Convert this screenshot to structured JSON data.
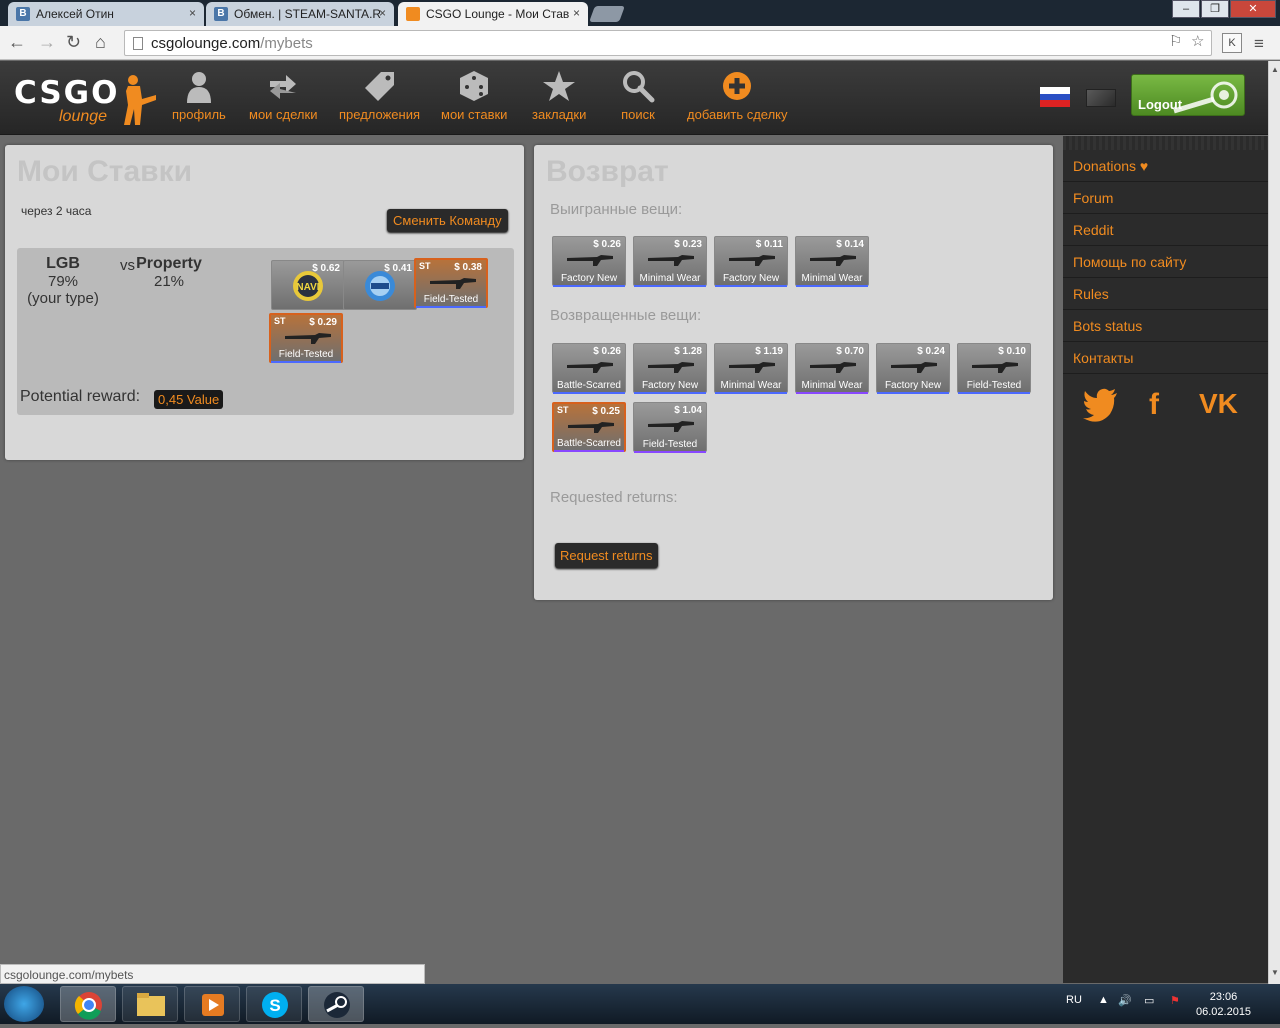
{
  "browser": {
    "tabs": [
      {
        "title": "Алексей Отин",
        "favicon": "vk-favicon",
        "icon_letter": "B"
      },
      {
        "title": "Обмен. | STEAM-SANTA.R",
        "favicon": "vk-favicon",
        "icon_letter": "B"
      },
      {
        "title": "CSGO Lounge - Мои Став",
        "favicon": "csgolounge-favicon",
        "icon_letter": "",
        "active": true
      }
    ],
    "close_glyph": "×",
    "url_domain": "csgolounge.com",
    "url_path": "/mybets",
    "status_url": "csgolounge.com/mybets",
    "ext_letter": "K"
  },
  "site": {
    "logo_text": "CSGO",
    "logo_sub": "lounge",
    "nav": [
      {
        "label": "профиль",
        "icon": "profile-icon"
      },
      {
        "label": "мои сделки",
        "icon": "trades-icon"
      },
      {
        "label": "предложения",
        "icon": "offers-tag-icon"
      },
      {
        "label": "мои ставки",
        "icon": "dice-icon"
      },
      {
        "label": "закладки",
        "icon": "star-icon"
      },
      {
        "label": "поиск",
        "icon": "search-icon"
      },
      {
        "label": "добавить сделку",
        "icon": "add-plus-icon"
      }
    ],
    "logout_label": "Logout"
  },
  "sidebar": {
    "links": [
      "Donations ♥",
      "Forum",
      "Reddit",
      "Помощь по сайту",
      "Rules",
      "Bots status",
      "Контакты"
    ],
    "social": [
      {
        "name": "twitter-icon",
        "glyph": "t"
      },
      {
        "name": "facebook-icon",
        "glyph": "f"
      },
      {
        "name": "vk-icon",
        "glyph": "VK"
      }
    ]
  },
  "my_bets": {
    "title": "Мои Ставки",
    "time_text": "через 2 часа",
    "change_team_label": "Сменить Команду",
    "team1": {
      "name": "LGB",
      "percent": "79%",
      "note": "(your type)"
    },
    "vs_text": "vs",
    "team2": {
      "name": "Property",
      "percent": "21%"
    },
    "items": [
      {
        "price": "$ 0.62",
        "condition": "",
        "st": false,
        "kind": "sticker-navi"
      },
      {
        "price": "$ 0.41",
        "condition": "",
        "st": false,
        "kind": "sticker-blue"
      },
      {
        "price": "$ 0.38",
        "condition": "Field-Tested",
        "st": true,
        "kind": "gun"
      },
      {
        "price": "$ 0.29",
        "condition": "Field-Tested",
        "st": true,
        "kind": "gun"
      }
    ],
    "reward_label": "Potential reward:",
    "reward_value": "0,45 Value"
  },
  "returns": {
    "title": "Возврат",
    "won_label": "Выигранные вещи:",
    "won_items": [
      {
        "price": "$ 0.26",
        "condition": "Factory New",
        "st": false,
        "bar": "#4b69ff"
      },
      {
        "price": "$ 0.23",
        "condition": "Minimal Wear",
        "st": false,
        "bar": "#4b69ff"
      },
      {
        "price": "$ 0.11",
        "condition": "Factory New",
        "st": false,
        "bar": "#4b69ff"
      },
      {
        "price": "$ 0.14",
        "condition": "Minimal Wear",
        "st": false,
        "bar": "#4b69ff"
      }
    ],
    "returned_label": "Возвращенные вещи:",
    "returned_items": [
      {
        "price": "$ 0.26",
        "condition": "Battle-Scarred",
        "st": false,
        "bar": "#4b69ff"
      },
      {
        "price": "$ 1.28",
        "condition": "Factory New",
        "st": false,
        "bar": "#4b69ff"
      },
      {
        "price": "$ 1.19",
        "condition": "Minimal Wear",
        "st": false,
        "bar": "#4b69ff"
      },
      {
        "price": "$ 0.70",
        "condition": "Minimal Wear",
        "st": false,
        "bar": "#8847ff"
      },
      {
        "price": "$ 0.24",
        "condition": "Factory New",
        "st": false,
        "bar": "#4b69ff"
      },
      {
        "price": "$ 0.10",
        "condition": "Field-Tested",
        "st": false,
        "bar": "#4b69ff"
      },
      {
        "price": "$ 0.25",
        "condition": "Battle-Scarred",
        "st": true,
        "bar": "#8847ff"
      },
      {
        "price": "$ 1.04",
        "condition": "Field-Tested",
        "st": false,
        "bar": "#8847ff"
      }
    ],
    "requested_label": "Requested returns:",
    "request_button": "Request returns"
  },
  "taskbar": {
    "apps": [
      "chrome",
      "explorer",
      "media-player",
      "skype",
      "steam"
    ],
    "lang": "RU",
    "time": "23:06",
    "date": "06.02.2015"
  },
  "colors": {
    "accent": "#f08b20",
    "header": "#2f2f2f",
    "panel": "#d8d8d8",
    "st_border": "#d7611d"
  }
}
